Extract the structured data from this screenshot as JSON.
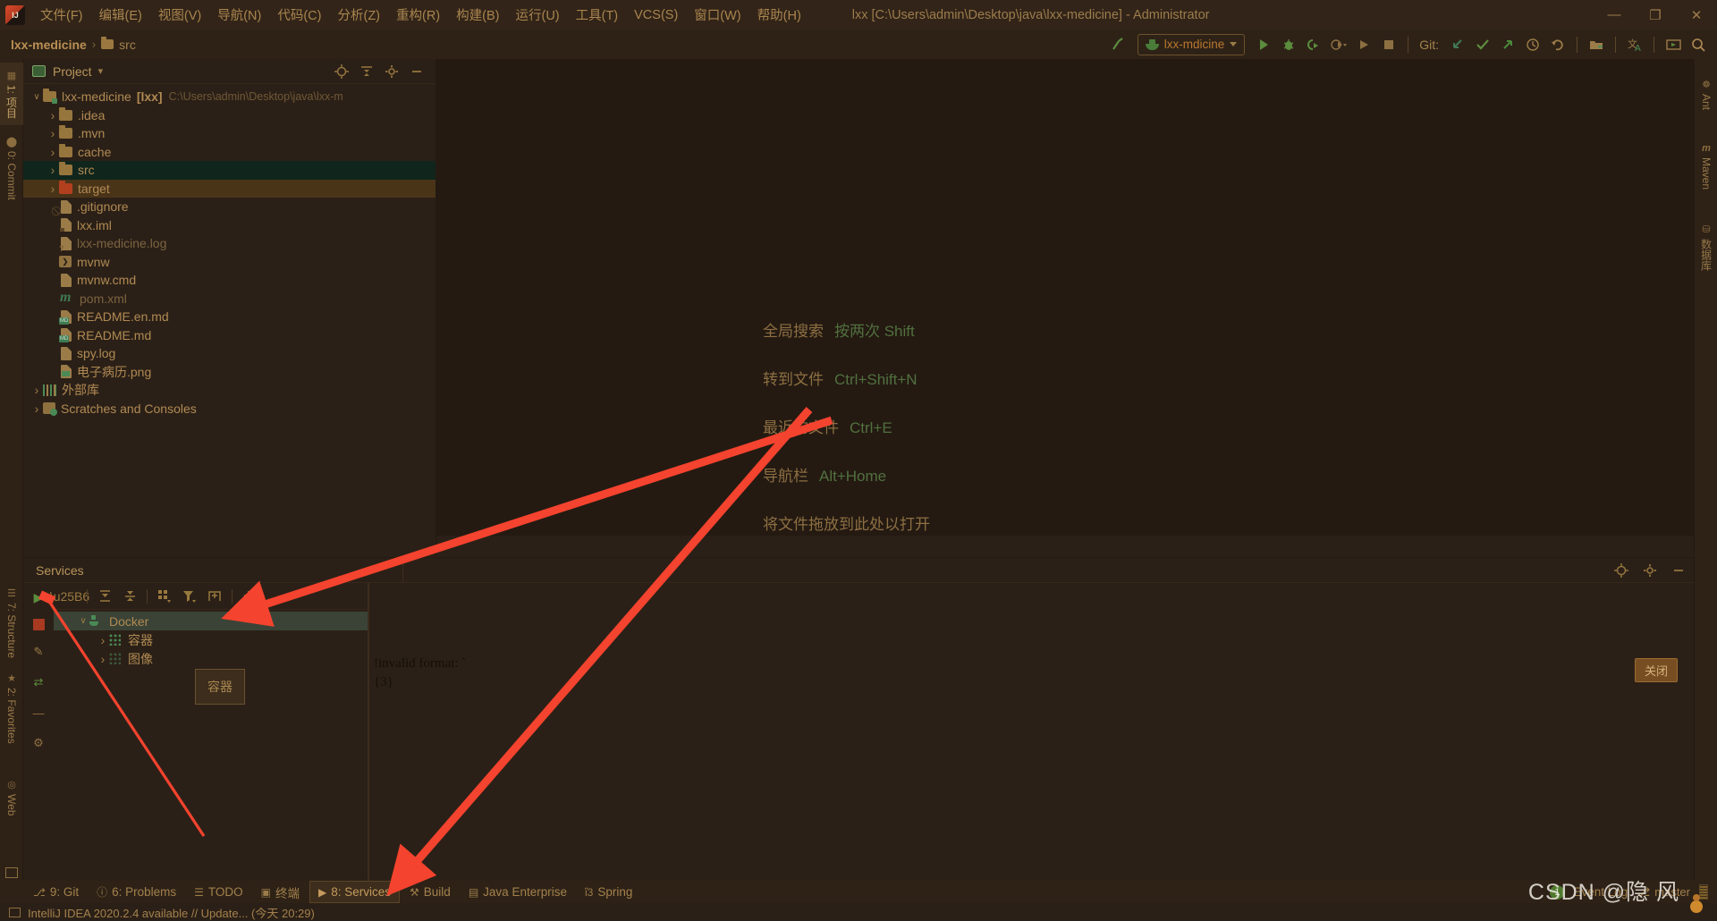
{
  "window": {
    "title": "lxx [C:\\Users\\admin\\Desktop\\java\\lxx-medicine] - Administrator",
    "minimize": "—",
    "maximize": "❐",
    "close": "✕"
  },
  "menu": {
    "items": [
      {
        "label": "文件(F)"
      },
      {
        "label": "编辑(E)"
      },
      {
        "label": "视图(V)"
      },
      {
        "label": "导航(N)"
      },
      {
        "label": "代码(C)"
      },
      {
        "label": "分析(Z)"
      },
      {
        "label": "重构(R)"
      },
      {
        "label": "构建(B)"
      },
      {
        "label": "运行(U)"
      },
      {
        "label": "工具(T)"
      },
      {
        "label": "VCS(S)"
      },
      {
        "label": "窗口(W)"
      },
      {
        "label": "帮助(H)"
      }
    ]
  },
  "breadcrumb": {
    "project": "lxx-medicine",
    "separator": "›",
    "file": "src"
  },
  "toolbar": {
    "run_config": "lxx-mdicine",
    "git_label": "Git:",
    "icons": {
      "build": "build-hammer-icon",
      "run": "run-icon",
      "debug": "debug-icon",
      "coverage": "run-with-coverage-icon",
      "profiler": "profiler-icon",
      "rerun": "rerun-icon",
      "stop": "stop-icon",
      "update": "git-update-icon",
      "commit": "git-commit-icon",
      "push": "git-push-icon",
      "history": "git-history-icon",
      "rollback": "git-rollback-icon",
      "explorer": "show-in-explorer-icon",
      "translate": "translate-icon",
      "presentation": "presentation-icon",
      "search": "search-everywhere-icon"
    }
  },
  "left_strip": {
    "items": [
      {
        "label": "1: 项目",
        "icon": "project-icon",
        "active": true
      },
      {
        "label": "0: Commit",
        "icon": "commit-icon",
        "active": false
      },
      {
        "label": "7: Structure",
        "icon": "structure-icon",
        "active": false
      },
      {
        "label": "2: Favorites",
        "icon": "star-icon",
        "active": false
      },
      {
        "label": "Web",
        "icon": "web-icon",
        "active": false
      }
    ]
  },
  "right_strip": {
    "items": [
      {
        "label": "Ant",
        "icon": "ant-icon"
      },
      {
        "label": "Maven",
        "icon": "maven-icon"
      },
      {
        "label": "数据库",
        "icon": "database-icon"
      }
    ]
  },
  "project_panel": {
    "title": "Project",
    "dropdown": "▾",
    "tree": [
      {
        "level": 0,
        "arrow": "open",
        "icon": "folder-src",
        "label": "lxx-medicine",
        "suffix": "[lxx]",
        "hint": "C:\\Users\\admin\\Desktop\\java\\lxx-m",
        "state": "none"
      },
      {
        "level": 1,
        "arrow": "closed",
        "icon": "folder",
        "label": ".idea",
        "state": "none"
      },
      {
        "level": 1,
        "arrow": "closed",
        "icon": "folder",
        "label": ".mvn",
        "state": "none"
      },
      {
        "level": 1,
        "arrow": "closed",
        "icon": "folder",
        "label": "cache",
        "state": "none"
      },
      {
        "level": 1,
        "arrow": "closed",
        "icon": "folder",
        "label": "src",
        "state": "selected-src"
      },
      {
        "level": 1,
        "arrow": "closed",
        "icon": "folder-red",
        "label": "target",
        "state": "selected-target"
      },
      {
        "level": 1,
        "arrow": "none",
        "icon": "file-git",
        "label": ".gitignore",
        "state": "none"
      },
      {
        "level": 1,
        "arrow": "none",
        "icon": "file-iml",
        "label": "lxx.iml",
        "state": "none"
      },
      {
        "level": 1,
        "arrow": "none",
        "icon": "file-q",
        "label": "lxx-medicine.log",
        "state": "grey"
      },
      {
        "level": 1,
        "arrow": "none",
        "icon": "file-sh",
        "label": "mvnw",
        "state": "none"
      },
      {
        "level": 1,
        "arrow": "none",
        "icon": "file",
        "label": "mvnw.cmd",
        "state": "none"
      },
      {
        "level": 1,
        "arrow": "none",
        "icon": "file-maven",
        "label": "pom.xml",
        "state": "grey"
      },
      {
        "level": 1,
        "arrow": "none",
        "icon": "file-md",
        "label": "README.en.md",
        "state": "none"
      },
      {
        "level": 1,
        "arrow": "none",
        "icon": "file-md",
        "label": "README.md",
        "state": "none"
      },
      {
        "level": 1,
        "arrow": "none",
        "icon": "file",
        "label": "spy.log",
        "state": "none"
      },
      {
        "level": 1,
        "arrow": "none",
        "icon": "file-img",
        "label": "电子病历.png",
        "state": "none"
      },
      {
        "level": 0,
        "arrow": "closed",
        "icon": "library",
        "label": "外部库",
        "state": "none"
      },
      {
        "level": 0,
        "arrow": "closed",
        "icon": "scratch",
        "label": "Scratches and Consoles",
        "state": "none"
      }
    ]
  },
  "editor": {
    "hints": [
      {
        "key": "全局搜索",
        "value": "按两次 Shift"
      },
      {
        "key": "转到文件",
        "value": "Ctrl+Shift+N"
      },
      {
        "key": "最近的文件",
        "value": "Ctrl+E"
      },
      {
        "key": "导航栏",
        "value": "Alt+Home"
      },
      {
        "key": "将文件拖放到此处以打开",
        "value": ""
      }
    ]
  },
  "services": {
    "title": "Services",
    "toolbar_icons": [
      {
        "name": "expand-all-icon"
      },
      {
        "name": "collapse-all-icon"
      },
      {
        "name": "group-by-icon"
      },
      {
        "name": "filter-icon"
      },
      {
        "name": "new-tab-icon"
      },
      {
        "name": "add-icon"
      }
    ],
    "gutter_icons": [
      {
        "name": "run-service-icon"
      },
      {
        "name": "stop-service-icon"
      },
      {
        "name": "edit-configuration-icon"
      },
      {
        "name": "deploy-icon"
      },
      {
        "name": "remove-icon"
      },
      {
        "name": "settings-icon"
      }
    ],
    "tree": [
      {
        "level": 0,
        "arrow": "open",
        "icon": "docker-icon",
        "label": "Docker",
        "selected": true
      },
      {
        "level": 1,
        "arrow": "closed",
        "icon": "grid-icon",
        "label": "容器",
        "selected": false
      },
      {
        "level": 1,
        "arrow": "closed",
        "icon": "grid-icon-dim",
        "label": "图像",
        "selected": false
      }
    ],
    "tooltip": "容器",
    "error_lines": [
      "!invalid format: `",
      "{3}"
    ],
    "close_button": "关闭"
  },
  "bottom_tabs": [
    {
      "label": "9: Git",
      "num": "9",
      "rest": ": Git",
      "icon": "git-branch-icon",
      "active": false
    },
    {
      "label": "6: Problems",
      "num": "6",
      "rest": ": Problems",
      "icon": "problems-icon",
      "active": false
    },
    {
      "label": "TODO",
      "num": "",
      "rest": "TODO",
      "icon": "todo-icon",
      "active": false
    },
    {
      "label": "终端",
      "num": "",
      "rest": "终端",
      "icon": "terminal-icon",
      "active": false
    },
    {
      "label": "8: Services",
      "num": "8",
      "rest": ": Services",
      "icon": "services-icon",
      "active": true
    },
    {
      "label": "Build",
      "num": "",
      "rest": "Build",
      "icon": "build-icon",
      "active": false
    },
    {
      "label": "Java Enterprise",
      "num": "",
      "rest": "Java Enterprise",
      "icon": "java-enterprise-icon",
      "active": false
    },
    {
      "label": "Spring",
      "num": "",
      "rest": "Spring",
      "icon": "spring-icon",
      "active": false
    }
  ],
  "bottom_right": {
    "event_log_count": "1",
    "event_log_label": "Event Log",
    "branch": "master"
  },
  "statusbar": {
    "message": "IntelliJ IDEA 2020.2.4 available // Update... (今天 20:29)"
  },
  "watermark": {
    "text": "CSDN @隐 风"
  },
  "colors": {
    "accent_green": "#4f7a2e",
    "accent_orange": "#b9772f",
    "arrow_red": "#f4432e",
    "selection_src": "#10251c",
    "selection_target": "#4a3418"
  }
}
